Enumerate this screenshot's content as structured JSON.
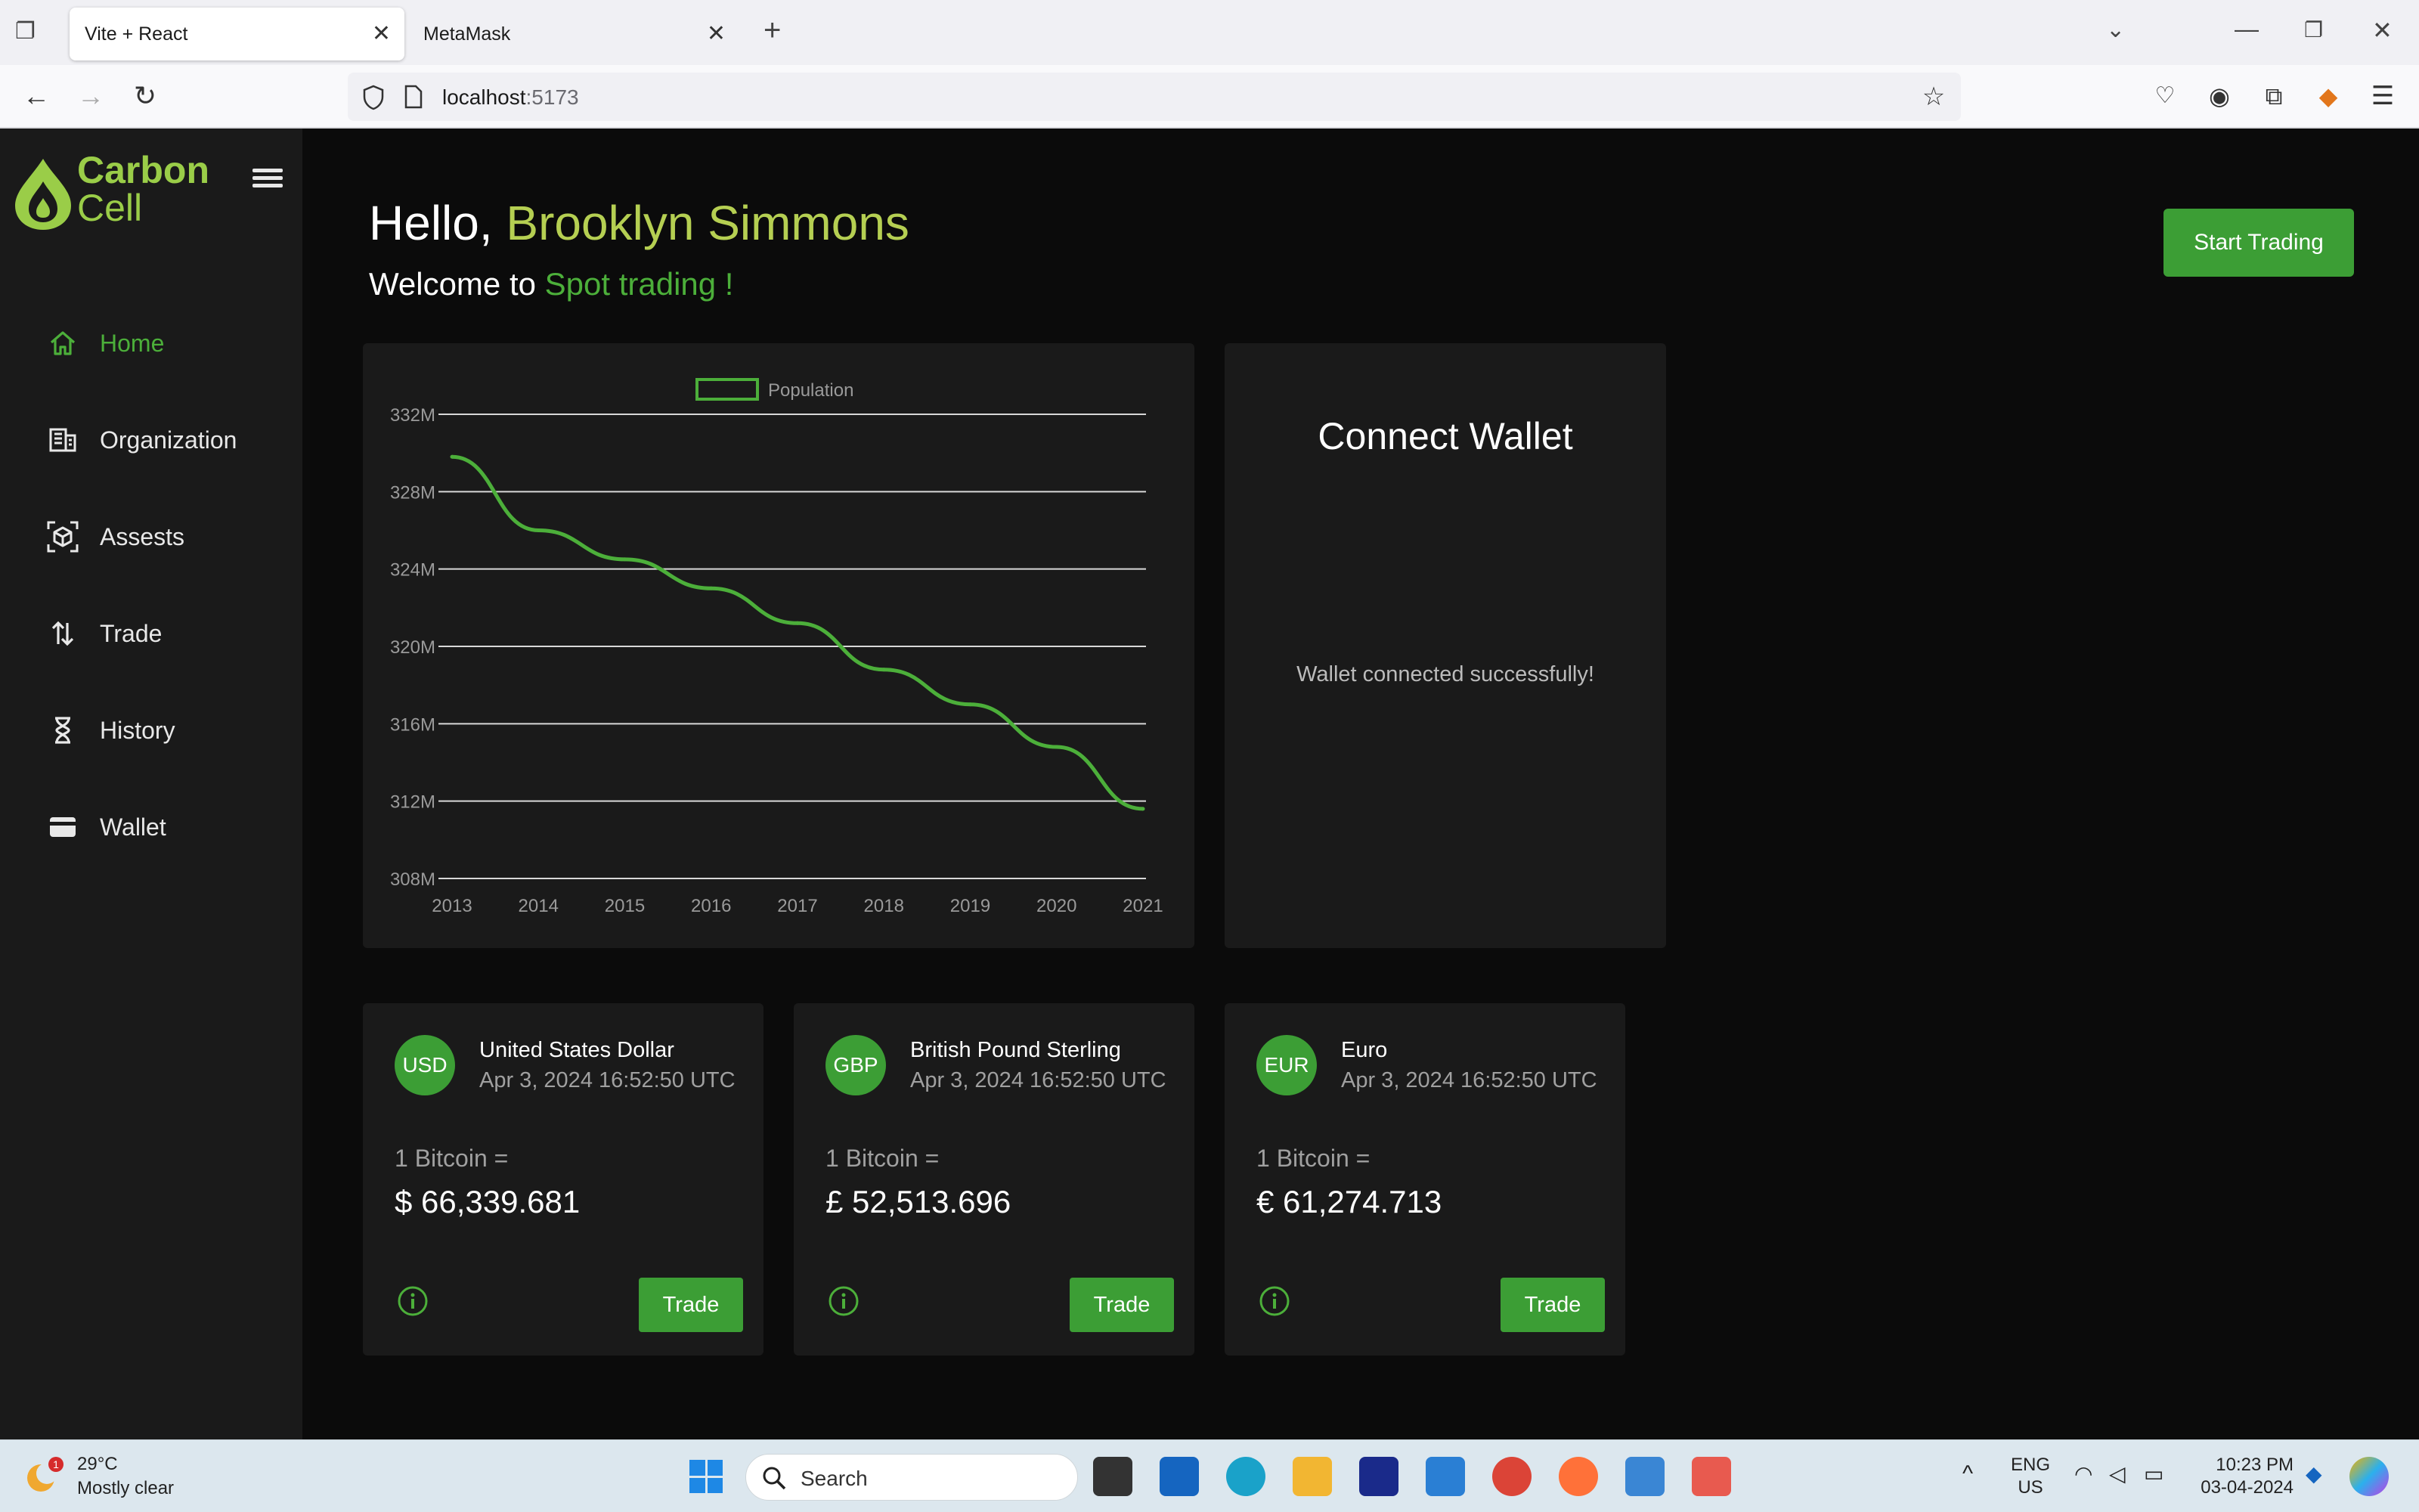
{
  "browser": {
    "tabs": [
      {
        "title": "Vite + React",
        "active": true
      },
      {
        "title": "MetaMask",
        "active": false
      }
    ],
    "url_host": "localhost",
    "url_port": ":5173"
  },
  "brand": {
    "line1": "Carbon",
    "line2": "Cell",
    "color": "#9acd48"
  },
  "sidebar": {
    "items": [
      {
        "label": "Home",
        "icon": "home-icon",
        "active": true
      },
      {
        "label": "Organization",
        "icon": "organization-icon",
        "active": false
      },
      {
        "label": "Assests",
        "icon": "assets-icon",
        "active": false
      },
      {
        "label": "Trade",
        "icon": "trade-arrows-icon",
        "active": false
      },
      {
        "label": "History",
        "icon": "hourglass-icon",
        "active": false
      },
      {
        "label": "Wallet",
        "icon": "wallet-icon",
        "active": false
      }
    ]
  },
  "header": {
    "hello": "Hello, ",
    "user_name": "Brooklyn Simmons",
    "welcome": "Welcome to ",
    "welcome_highlight": "Spot trading !",
    "start_trading": "Start Trading"
  },
  "chart_data": {
    "type": "line",
    "categories": [
      "2013",
      "2014",
      "2015",
      "2016",
      "2017",
      "2018",
      "2019",
      "2020",
      "2021"
    ],
    "series": [
      {
        "name": "Population",
        "values": [
          329.8,
          326.0,
          324.5,
          323.0,
          321.2,
          318.8,
          317.0,
          314.8,
          311.6
        ],
        "color": "#4caf3a"
      }
    ],
    "y_ticks": [
      "308M",
      "312M",
      "316M",
      "320M",
      "324M",
      "328M",
      "332M"
    ],
    "ylim": [
      308,
      332
    ],
    "grid": true,
    "legend": "top-center"
  },
  "wallet": {
    "title": "Connect Wallet",
    "message": "Wallet connected successfully!"
  },
  "currencies": [
    {
      "code": "USD",
      "name": "United States Dollar",
      "date": "Apr 3, 2024 16:52:50 UTC",
      "label": "1 Bitcoin =",
      "value": "$ 66,339.681",
      "trade": "Trade"
    },
    {
      "code": "GBP",
      "name": "British Pound Sterling",
      "date": "Apr 3, 2024 16:52:50 UTC",
      "label": "1 Bitcoin =",
      "value": "£ 52,513.696",
      "trade": "Trade"
    },
    {
      "code": "EUR",
      "name": "Euro",
      "date": "Apr 3, 2024 16:52:50 UTC",
      "label": "1 Bitcoin =",
      "value": "€ 61,274.713",
      "trade": "Trade"
    }
  ],
  "taskbar": {
    "temp": "29°C",
    "weather": "Mostly clear",
    "weather_badge": "1",
    "search": "Search",
    "lang1": "ENG",
    "lang2": "US",
    "time": "10:23 PM",
    "date": "03-04-2024"
  },
  "colors": {
    "accent": "#4caf3a",
    "button": "#3c9e35",
    "name": "#b5cf52"
  }
}
